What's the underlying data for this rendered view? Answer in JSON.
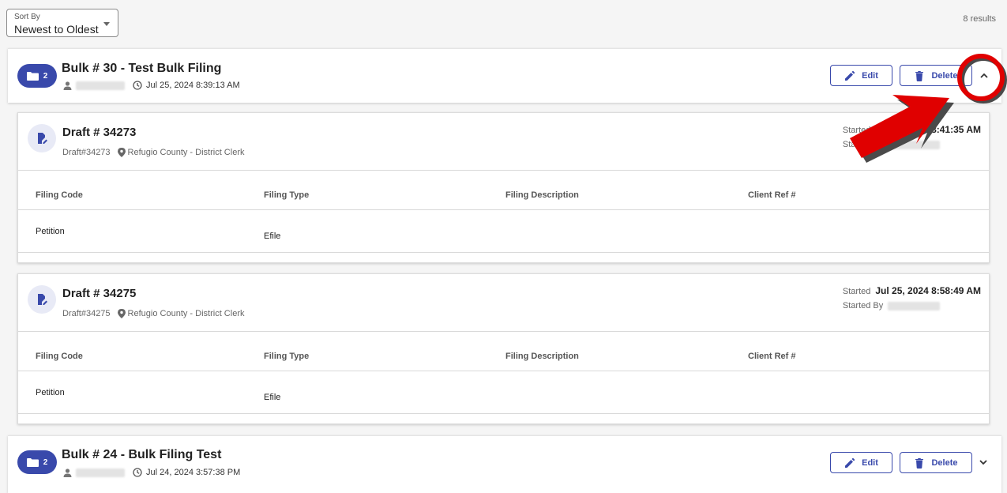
{
  "sort": {
    "label": "Sort By",
    "value": "Newest to Oldest"
  },
  "results_count": "8 results",
  "bulks": [
    {
      "badge_count": "2",
      "title": "Bulk # 30 - Test Bulk Filing",
      "timestamp": "Jul 25, 2024 8:39:13 AM",
      "edit_label": "Edit",
      "delete_label": "Delete",
      "expanded": true
    },
    {
      "badge_count": "2",
      "title": "Bulk # 24 - Bulk Filing Test",
      "timestamp": "Jul 24, 2024 3:57:38 PM",
      "edit_label": "Edit",
      "delete_label": "Delete",
      "expanded": false
    }
  ],
  "drafts": [
    {
      "title": "Draft # 34273",
      "id": "Draft#34273",
      "location": "Refugio County - District Clerk",
      "started_label": "Started",
      "started_value": "Jul 25, 2024 8:41:35 AM",
      "started_by_label": "Started By",
      "columns": [
        "Filing Code",
        "Filing Type",
        "Filing Description",
        "Client Ref #"
      ],
      "row": {
        "filing_code": "Petition",
        "filing_type": "Efile"
      }
    },
    {
      "title": "Draft # 34275",
      "id": "Draft#34275",
      "location": "Refugio County - District Clerk",
      "started_label": "Started",
      "started_value": "Jul 25, 2024 8:58:49 AM",
      "started_by_label": "Started By",
      "columns": [
        "Filing Code",
        "Filing Type",
        "Filing Description",
        "Client Ref #"
      ],
      "row": {
        "filing_code": "Petition",
        "filing_type": "Efile"
      }
    }
  ],
  "colors": {
    "primary": "#3949ab",
    "annotation": "#e00000"
  },
  "icons": [
    "folder-icon",
    "person-icon",
    "clock-icon",
    "pencil-icon",
    "trash-icon",
    "chevron-up-icon",
    "chevron-down-icon",
    "draft-file-icon",
    "location-pin-icon",
    "caret-down-icon"
  ]
}
